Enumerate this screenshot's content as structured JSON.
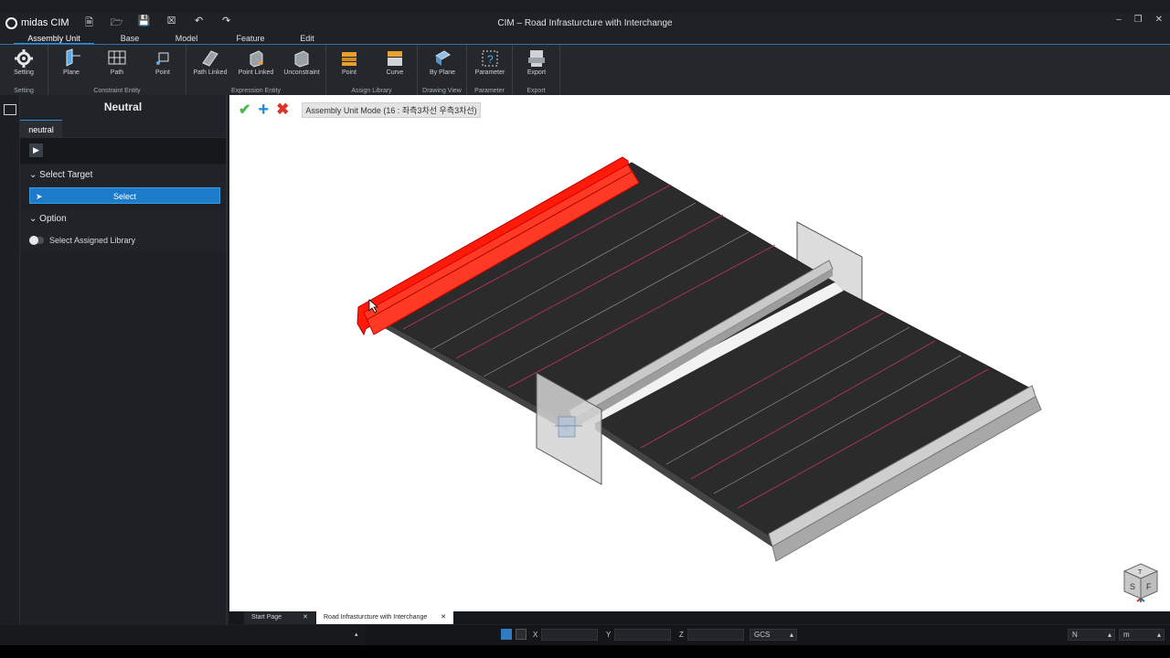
{
  "app": {
    "logo_text": "midas CIM",
    "window_title": "CIM – Road Infrasturcture with Interchange",
    "quick_access": [
      "🗎",
      "🗁",
      "💾",
      "☒",
      "↶",
      "↷"
    ],
    "window_controls": [
      "–",
      "❐",
      "✕"
    ]
  },
  "menu_tabs": [
    {
      "label": "Assembly Unit",
      "active": true
    },
    {
      "label": "Base",
      "active": false
    },
    {
      "label": "Model",
      "active": false
    },
    {
      "label": "Feature",
      "active": false
    },
    {
      "label": "Edit",
      "active": false
    }
  ],
  "ribbon": {
    "groups": {
      "setting": "Setting",
      "constraint_entity": "Constraint Entity",
      "expression_entity": "Expression Entity",
      "assign_library": "Assign Library",
      "drawing_view": "Drawing View",
      "parameter": "Parameter",
      "export": "Export"
    },
    "tools": {
      "setting": "Setting",
      "plane": "Plane",
      "path": "Path",
      "point": "Point",
      "path_linked": "Path Linked",
      "point_linked": "Point Linked",
      "unconstraint": "Unconstraint",
      "lib_point": "Point",
      "lib_curve": "Curve",
      "by_plane": "By Plane",
      "parameter": "Parameter",
      "export": "Export"
    }
  },
  "panel": {
    "title": "Neutral",
    "tab": "neutral",
    "cursor_glyph": "▶",
    "select_target": {
      "header": "Select Target",
      "button_label": "Select"
    },
    "option": {
      "header": "Option",
      "toggle_label": "Select Assigned Library",
      "toggle_on": false
    }
  },
  "viewport": {
    "mode_label": "Assembly Unit Mode (16 : 좌측3차선 우측3차선)",
    "accent_selected": "#ff1a0a",
    "cube_faces": {
      "top": "T",
      "front_left": "S",
      "front_right": "F"
    }
  },
  "doc_tabs": [
    {
      "label": "Start Page",
      "active": false
    },
    {
      "label": "Road Infrasturcture with Interchange",
      "active": true
    }
  ],
  "status_bar": {
    "x_label": "X",
    "y_label": "Y",
    "z_label": "Z",
    "coord_system": "GCS",
    "force_unit": "N",
    "length_unit": "m"
  }
}
